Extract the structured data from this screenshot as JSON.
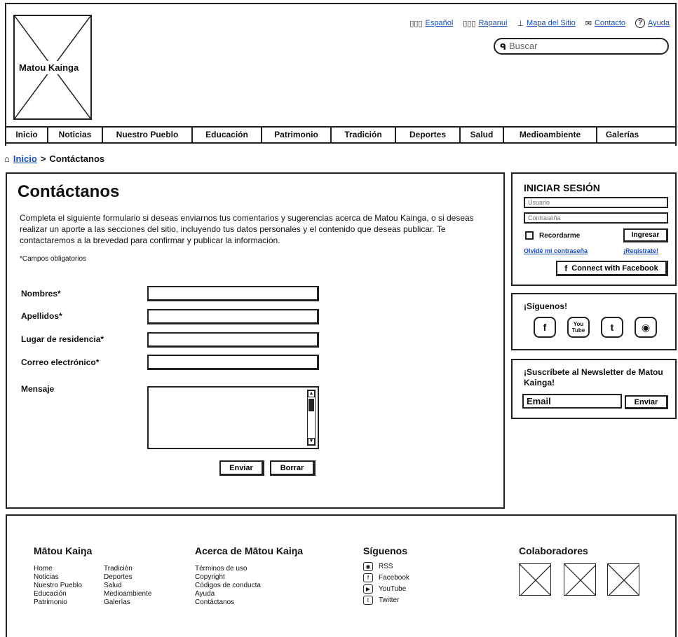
{
  "header": {
    "logo_text": "Matou Kainga",
    "links": [
      {
        "icon": "flag-icon",
        "label": "Español"
      },
      {
        "icon": "flag-icon",
        "label": "Rapanui"
      },
      {
        "icon": "sitemap-icon",
        "label": "Mapa del Sitio"
      },
      {
        "icon": "mail-icon",
        "label": "Contacto"
      },
      {
        "icon": "help-icon",
        "label": "Ayuda"
      }
    ],
    "search_placeholder": "Buscar"
  },
  "nav": {
    "tabs": [
      "Inicio",
      "Noticias",
      "Nuestro Pueblo",
      "Educación",
      "Patrimonio",
      "Tradición",
      "Deportes",
      "Salud",
      "Medioambiente",
      "Galerías"
    ]
  },
  "breadcrumb": {
    "home": "Inicio",
    "separator": ">",
    "current": "Contáctanos"
  },
  "main": {
    "title": "Contáctanos",
    "intro": "Completa el siguiente formulario si deseas enviarnos tus comentarios y sugerencias acerca de Matou Kainga, o si deseas realizar un aporte a las secciones del sitio, incluyendo tus datos personales y el contenido que deseas publicar. Te contactaremos a la brevedad para confirmar y publicar la información.",
    "required_note": "*Campos obligatorios",
    "fields": {
      "nombres": "Nombres*",
      "apellidos": "Apellidos*",
      "residencia": "Lugar de residencia*",
      "correo": "Correo electrónico*",
      "mensaje": "Mensaje"
    },
    "buttons": {
      "send": "Enviar",
      "clear": "Borrar"
    }
  },
  "login": {
    "title": "INICIAR SESIÓN",
    "user_placeholder": "Usuario",
    "password_placeholder": "Contraseña",
    "remember": "Recordarme",
    "submit": "Ingresar",
    "forgot": "Olvidé mi contraseña",
    "register": "¡Regístrate!",
    "facebook": "Connect with Facebook"
  },
  "follow": {
    "title": "¡Síguenos!",
    "icons": [
      "facebook-icon",
      "youtube-icon",
      "twitter-icon",
      "rss-icon"
    ]
  },
  "newsletter": {
    "title": "¡Suscríbete al Newsletter de Matou Kainga!",
    "email_placeholder": "Email",
    "submit": "Enviar"
  },
  "footer": {
    "col1": {
      "title": "Mātou Kaiŋa",
      "left": [
        "Home",
        "Noticias",
        "Nuestro Pueblo",
        "Educación",
        "Patrimonio"
      ],
      "right": [
        "Tradición",
        "Deportes",
        "Salud",
        "Medioambiente",
        "Galerías"
      ]
    },
    "col2": {
      "title": "Acerca de Mātou Kaiŋa",
      "items": [
        "Términos de uso",
        "Copyright",
        "Códigos de conducta",
        "Ayuda",
        "Contáctanos"
      ]
    },
    "col3": {
      "title": "Síguenos",
      "items": [
        "RSS",
        "Facebook",
        "YouTube",
        "Twitter"
      ]
    },
    "col4": {
      "title": "Colaboradores"
    }
  }
}
